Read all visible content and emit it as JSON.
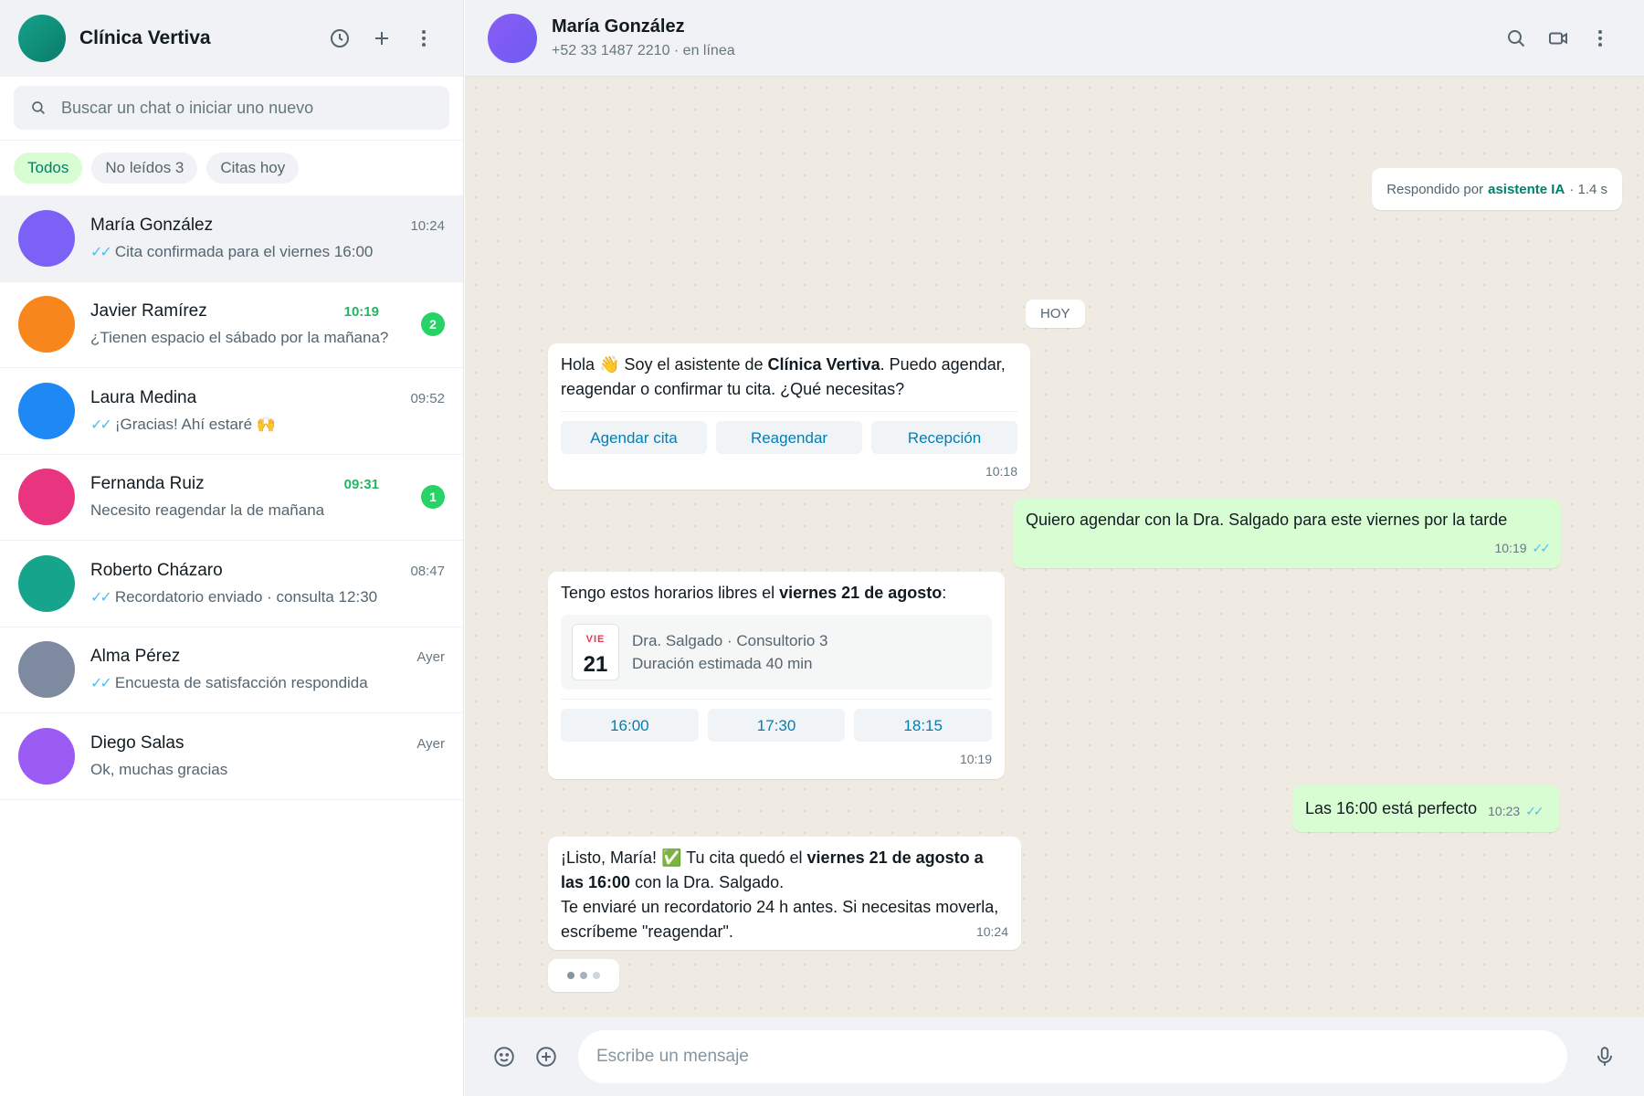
{
  "sidebar": {
    "brand_name": "Clínica Vertiva",
    "brand_color": "#0f8f7a",
    "header_icons": [
      "clock-icon",
      "plus-icon",
      "menu-icon"
    ],
    "search": {
      "placeholder": "Buscar un chat o iniciar uno nuevo"
    },
    "filters": [
      {
        "label": "Todos",
        "active": true
      },
      {
        "label": "No leídos 3",
        "active": false
      },
      {
        "label": "Citas hoy",
        "active": false
      }
    ],
    "chats": [
      {
        "name": "María González",
        "time": "10:24",
        "preview": "Cita confirmada para el viernes 16:00",
        "ticks": "✓✓",
        "unread": "",
        "color": "#7b61f5",
        "selected": true
      },
      {
        "name": "Javier Ramírez",
        "time": "10:19",
        "preview": "¿Tienen espacio el sábado por la mañana?",
        "ticks": "",
        "unread": "2",
        "color": "#f7861c",
        "selected": false
      },
      {
        "name": "Laura Medina",
        "time": "09:52",
        "preview": "¡Gracias! Ahí estaré 🙌",
        "ticks": "✓✓",
        "unread": "",
        "color": "#1e88f5",
        "selected": false
      },
      {
        "name": "Fernanda Ruiz",
        "time": "09:31",
        "preview": "Necesito reagendar la de mañana",
        "ticks": "",
        "unread": "1",
        "color": "#e9347f",
        "selected": false
      },
      {
        "name": "Roberto Cházaro",
        "time": "08:47",
        "preview": "Recordatorio enviado · consulta 12:30",
        "ticks": "✓✓",
        "unread": "",
        "color": "#16a58c",
        "selected": false
      },
      {
        "name": "Alma Pérez",
        "time": "Ayer",
        "preview": "Encuesta de satisfacción respondida",
        "ticks": "✓✓",
        "unread": "",
        "color": "#7d8aa0",
        "selected": false
      },
      {
        "name": "Diego Salas",
        "time": "Ayer",
        "preview": "Ok, muchas gracias",
        "ticks": "",
        "unread": "",
        "color": "#9a5cf2",
        "selected": false
      }
    ]
  },
  "conversation": {
    "contact_name": "María González",
    "contact_status": "+52 33 1487 2210 · en línea",
    "header_icons": [
      "search-icon",
      "video-icon",
      "menu-icon"
    ],
    "ai_note": {
      "prefix": "Respondido por",
      "agent": "asistente IA",
      "suffix": "· 1.4 s"
    },
    "day_label": "HOY",
    "messages": {
      "welcome": {
        "text_a": "Hola 👋 Soy el asistente de ",
        "bold": "Clínica Vertiva",
        "text_b": ". Puedo agendar, reagendar o confirmar tu cita. ¿Qué necesitas?",
        "buttons": [
          "Agendar cita",
          "Reagendar",
          "Recepción"
        ],
        "time": "10:18"
      },
      "request": {
        "text": "Quiero agendar con la Dra. Salgado para este viernes por la tarde",
        "time": "10:19",
        "ticks": "✓✓"
      },
      "slots": {
        "text_a": "Tengo estos horarios libres el ",
        "bold": "viernes 21 de agosto",
        "text_b": ":",
        "card": {
          "dow": "VIE",
          "day": "21",
          "line1": "Dra. Salgado · Consultorio 3",
          "line2": "Duración estimada 40 min"
        },
        "times": [
          "16:00",
          "17:30",
          "18:15"
        ],
        "time": "10:19"
      },
      "choice": {
        "text": "Las 16:00 está perfecto",
        "time": "10:23",
        "ticks": "✓✓"
      },
      "confirm": {
        "text_a": "¡Listo, María! ✅ Tu cita quedó el ",
        "bold": "viernes 21 de agosto a las 16:00",
        "text_b": " con la Dra. Salgado.",
        "text_c": "Te enviaré un recordatorio 24 h antes. Si necesitas moverla, escríbeme \"reagendar\".",
        "time": "10:24"
      }
    },
    "composer": {
      "placeholder": "Escribe un mensaje"
    }
  }
}
